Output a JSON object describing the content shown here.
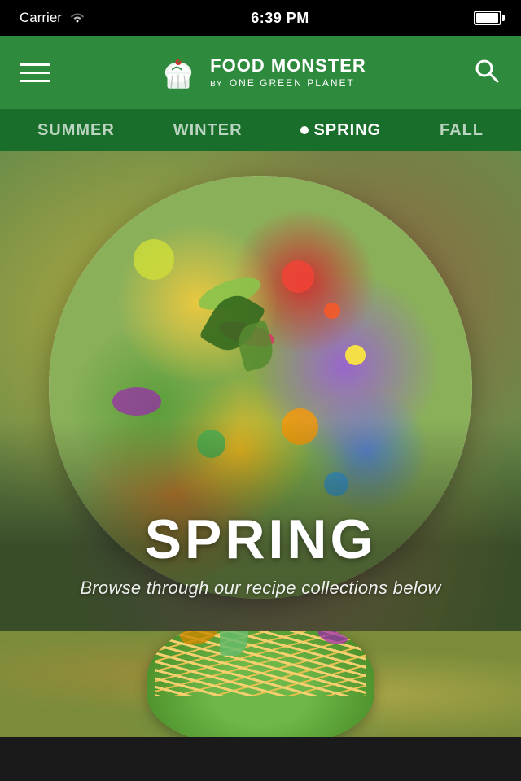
{
  "statusBar": {
    "carrier": "Carrier",
    "time": "6:39 PM"
  },
  "header": {
    "logoTitle": "FOOD MONSTER",
    "logoBy": "BY",
    "logoSub": "ONE GREEN PLANET",
    "menuLabel": "Menu",
    "searchLabel": "Search"
  },
  "seasonTabs": {
    "tabs": [
      {
        "id": "summer",
        "label": "SUMMER",
        "active": false
      },
      {
        "id": "winter",
        "label": "WINTER",
        "active": false
      },
      {
        "id": "spring",
        "label": "SPRING",
        "active": true
      },
      {
        "id": "fall",
        "label": "FALL",
        "active": false
      }
    ]
  },
  "hero": {
    "season": "SPRING",
    "subtitle": "Browse through our recipe collections below"
  },
  "colors": {
    "headerGreen": "#2e8b3e",
    "darkGreen": "#1a6e2c"
  }
}
